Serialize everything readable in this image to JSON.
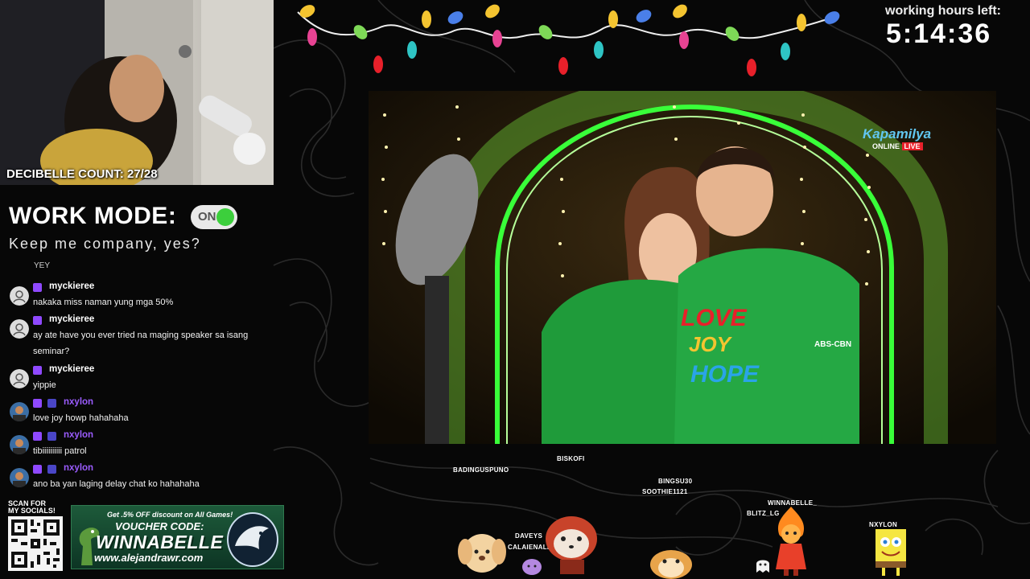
{
  "webcam": {
    "decibelle_count": "DECIBELLE COUNT: 27/28"
  },
  "work_mode": {
    "title": "WORK MODE:",
    "toggle_label": "ON",
    "subtitle": "Keep me company, yes?"
  },
  "chat": {
    "partial_top": "YEY",
    "messages": [
      {
        "user": "myckieree",
        "text": "nakaka miss naman yung mga 50%",
        "color": "#ffffff"
      },
      {
        "user": "myckieree",
        "text": "ay ate have you ever tried na maging speaker sa isang seminar?",
        "color": "#ffffff"
      },
      {
        "user": "myckieree",
        "text": "yippie",
        "color": "#ffffff"
      },
      {
        "user": "nxylon",
        "text": "love joy howp hahahaha",
        "color": "#9b5cff"
      },
      {
        "user": "nxylon",
        "text": "tibiiiiiiiiii patrol",
        "color": "#9b5cff"
      },
      {
        "user": "nxylon",
        "text": "ano ba yan laging delay chat ko hahahaha",
        "color": "#9b5cff"
      }
    ]
  },
  "socials": {
    "label_line1": "SCAN FOR",
    "label_line2": "MY SOCIALS!"
  },
  "voucher": {
    "promo": "Get .5% OFF discount on All Games!",
    "label": "VOUCHER CODE:",
    "code": "WINNABELLE",
    "url": "www.alejandrawr.com"
  },
  "timer": {
    "label": "working hours left:",
    "value": "5:14:36"
  },
  "video": {
    "channel_brand": "Kapamilya",
    "channel_online": "ONLINE",
    "channel_live": "LIVE",
    "shirt_line1": "LOVE",
    "shirt_line2": "JOY",
    "shirt_line3": "HOPE",
    "shirt_logo": "ABS-CBN"
  },
  "viewers": [
    "BISKOFI",
    "BADINGUSPUNO",
    "BINGSU30",
    "SOOTHIE1121",
    "WINNABELLE_",
    "BLITZ_LG",
    "NXYLON",
    "DAVEYS",
    "CALAIENALBUEZ"
  ],
  "colors": {
    "accent_green": "#3ccf3c",
    "twitch_purple": "#8f49ff",
    "background": "#070707"
  }
}
